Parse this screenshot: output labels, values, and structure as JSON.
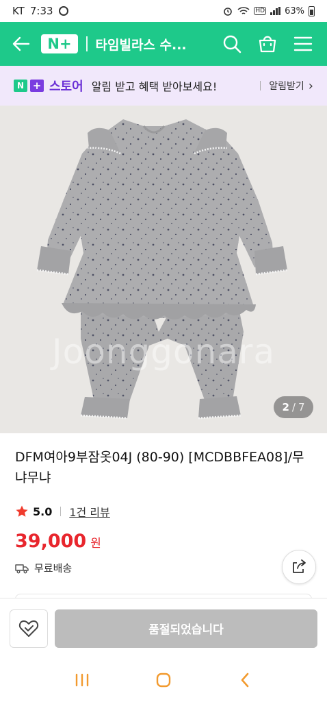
{
  "status_bar": {
    "carrier": "KT",
    "time": "7:33",
    "battery": "63%",
    "network": "HD"
  },
  "header": {
    "logo_text": "N+",
    "title": "타임빌라스 수...",
    "accent_color": "#1ec98a"
  },
  "store_banner": {
    "logo_n": "N",
    "logo_plus": "+",
    "store_name": "스토어",
    "message": "알림 받고 혜택 받아보세요!",
    "link_label": "알림받기",
    "link_arrow": "›",
    "background": "#f1e8fb"
  },
  "image": {
    "watermark": "Joonggonara",
    "current_page": "2",
    "separator": "/",
    "total_pages": "7"
  },
  "product": {
    "title": "DFM여아9부잠옷04J (80-90) [MCDBBFEA08]/무냐무냐",
    "rating": "5.0",
    "review_count_label": "1건 리뷰",
    "price": "39,000",
    "currency": "원",
    "shipping": "무료배송",
    "price_color": "#e8262d"
  },
  "actions": {
    "soldout_label": "품절되었습니다"
  },
  "icons": {
    "back": "back-arrow-icon",
    "search": "search-icon",
    "cart": "shopping-bag-icon",
    "menu": "hamburger-menu-icon",
    "star": "star-icon",
    "truck": "truck-icon",
    "share": "share-icon",
    "wish": "heart-check-icon"
  }
}
